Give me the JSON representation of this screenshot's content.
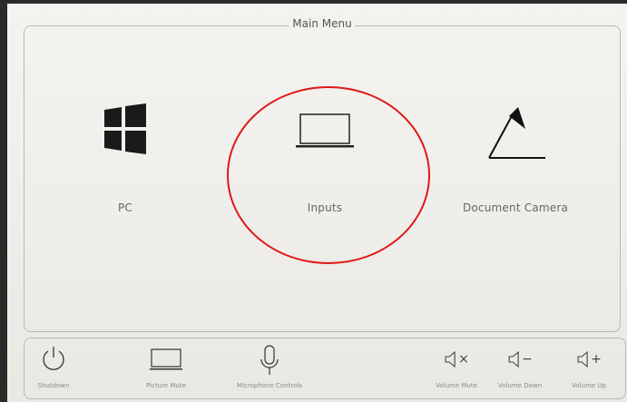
{
  "main_menu": {
    "title": "Main Menu",
    "tiles": [
      {
        "label": "PC",
        "icon": "windows-logo-icon"
      },
      {
        "label": "Inputs",
        "icon": "laptop-icon"
      },
      {
        "label": "Document Camera",
        "icon": "document-camera-icon"
      }
    ]
  },
  "bottom_bar": {
    "items": [
      {
        "label": "Shutdown",
        "icon": "power-icon"
      },
      {
        "label": "Picture Mute",
        "icon": "monitor-icon"
      },
      {
        "label": "Microphone Controls",
        "icon": "microphone-icon"
      },
      {
        "label": "Volume Mute",
        "icon": "volume-mute-icon",
        "glyph": "×"
      },
      {
        "label": "Volume Down",
        "icon": "volume-down-icon",
        "glyph": "−"
      },
      {
        "label": "Volume Up",
        "icon": "volume-up-icon",
        "glyph": "+"
      }
    ]
  },
  "colors": {
    "highlight_ring": "#e01818",
    "panel_background": "#f3f2ee",
    "icon_dark": "#1a1a1a"
  }
}
